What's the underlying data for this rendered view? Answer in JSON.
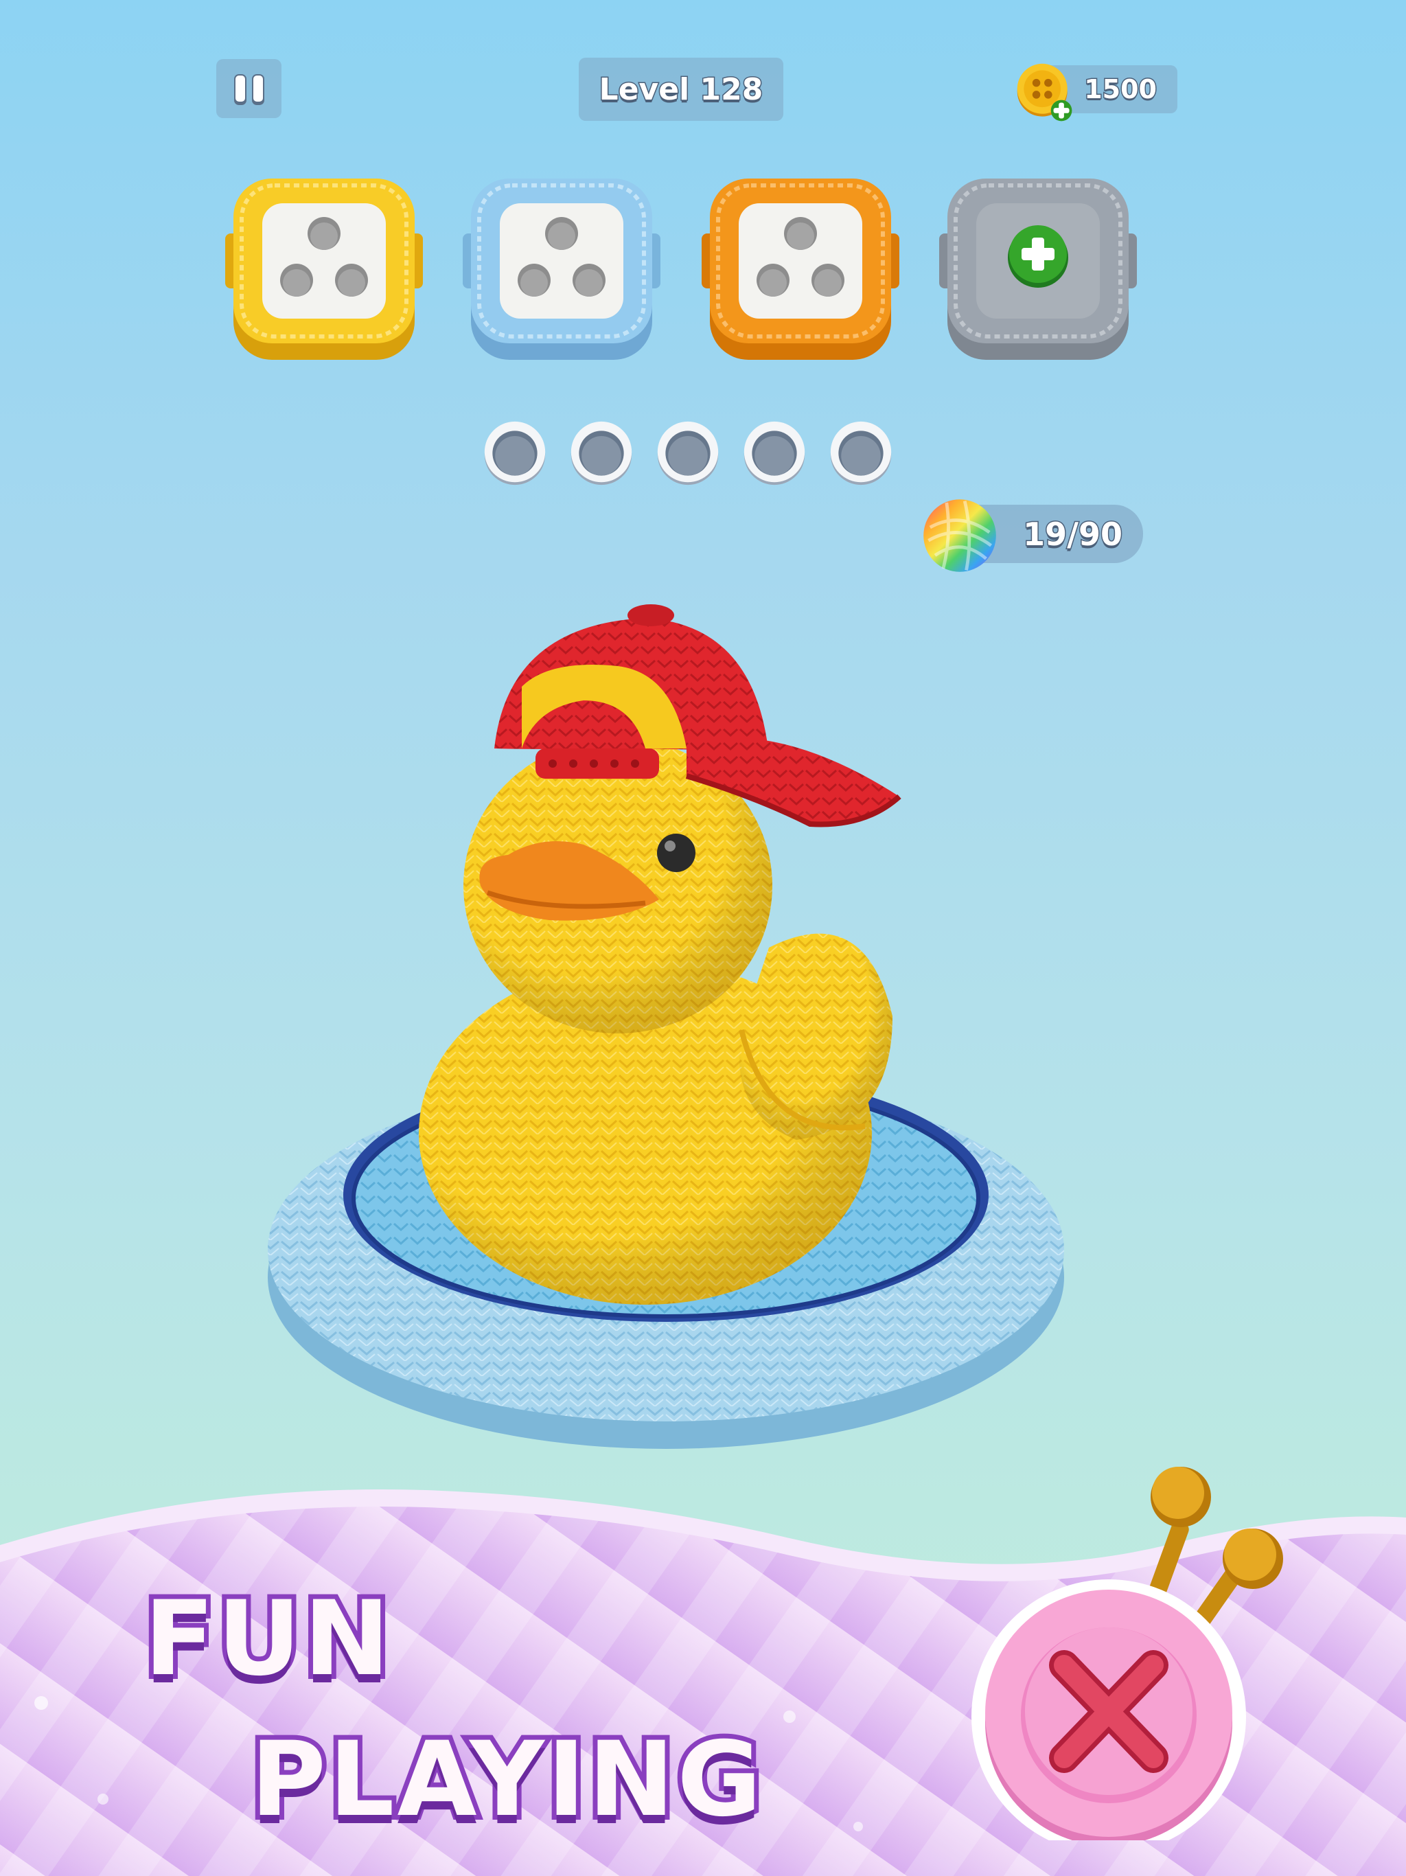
{
  "hud": {
    "level_label": "Level 128",
    "coins": "1500"
  },
  "spool_boxes": [
    {
      "color": "#f6c81e",
      "state": "holes-3"
    },
    {
      "color": "#8fc6ec",
      "state": "holes-3"
    },
    {
      "color": "#f29518",
      "state": "holes-3"
    },
    {
      "color": "#9aa3ad",
      "state": "locked-add"
    }
  ],
  "slots_count": 5,
  "yarn_counter": "19/90",
  "promo": {
    "line1": "FUN",
    "line2": "PLAYING"
  },
  "colors": {
    "duck": "#f9cf24",
    "cap": "#e0262d",
    "beak": "#f0871d",
    "pool_ring": "#a9d6ee",
    "pool_rim": "#2848a0",
    "banner": "#e8c8f4",
    "button": "#f59fd2"
  }
}
